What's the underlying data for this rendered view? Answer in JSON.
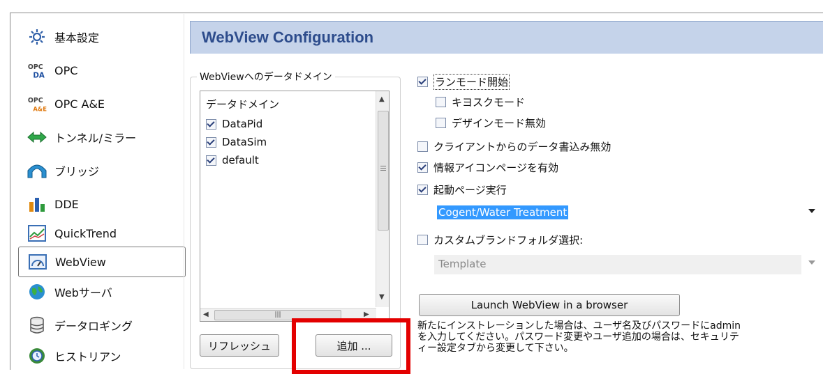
{
  "sidebar": {
    "items": [
      {
        "label": "基本設定",
        "icon": "gear-icon"
      },
      {
        "label": "OPC",
        "icon": "opc-da-icon"
      },
      {
        "label": "OPC A&E",
        "icon": "opc-ae-icon"
      },
      {
        "label": "トンネル/ミラー",
        "icon": "tunnel-icon"
      },
      {
        "label": "ブリッジ",
        "icon": "bridge-icon"
      },
      {
        "label": "DDE",
        "icon": "dde-icon"
      },
      {
        "label": "QuickTrend",
        "icon": "quicktrend-icon"
      },
      {
        "label": "WebView",
        "icon": "webview-icon"
      },
      {
        "label": "Webサーバ",
        "icon": "globe-icon"
      },
      {
        "label": "データロギング",
        "icon": "database-icon"
      },
      {
        "label": "ヒストリアン",
        "icon": "historian-icon"
      }
    ],
    "selected": "WebView"
  },
  "header": {
    "title": "WebView Configuration"
  },
  "domains": {
    "group_title": "WebViewへのデータドメイン",
    "column_header": "データドメイン",
    "items": [
      {
        "label": "DataPid",
        "checked": true
      },
      {
        "label": "DataSim",
        "checked": true
      },
      {
        "label": "default",
        "checked": true
      }
    ],
    "refresh_label": "リフレッシュ",
    "add_label": "追加 ..."
  },
  "options": {
    "run_mode": {
      "label": "ランモード開始",
      "checked": true
    },
    "kiosk": {
      "label": "キヨスクモード",
      "checked": false
    },
    "design_disable": {
      "label": "デザインモード無効",
      "checked": false
    },
    "client_write_disable": {
      "label": "クライアントからのデータ書込み無効",
      "checked": false
    },
    "info_icon_page": {
      "label": "情報アイコンページを有効",
      "checked": true
    },
    "startup_page": {
      "label": "起動ページ実行",
      "checked": true
    },
    "startup_page_value": "Cogent/Water Treatment",
    "custom_brand": {
      "label": "カスタムブランドフォルダ選択:",
      "checked": false
    },
    "brand_value": "Template",
    "launch_label": "Launch WebView in a browser",
    "notes": "新たにインストレーションした場合は、ユーザ名及びパスワードにadmin\nを入力してください。パスワード変更やユーザ追加の場合は、セキュリテ\nィー設定タブから変更して下さい。"
  },
  "colors": {
    "header_bg": "#c5d3ea",
    "header_text": "#2d4c8c",
    "highlight": "#e30000",
    "selection": "#3399ff"
  }
}
